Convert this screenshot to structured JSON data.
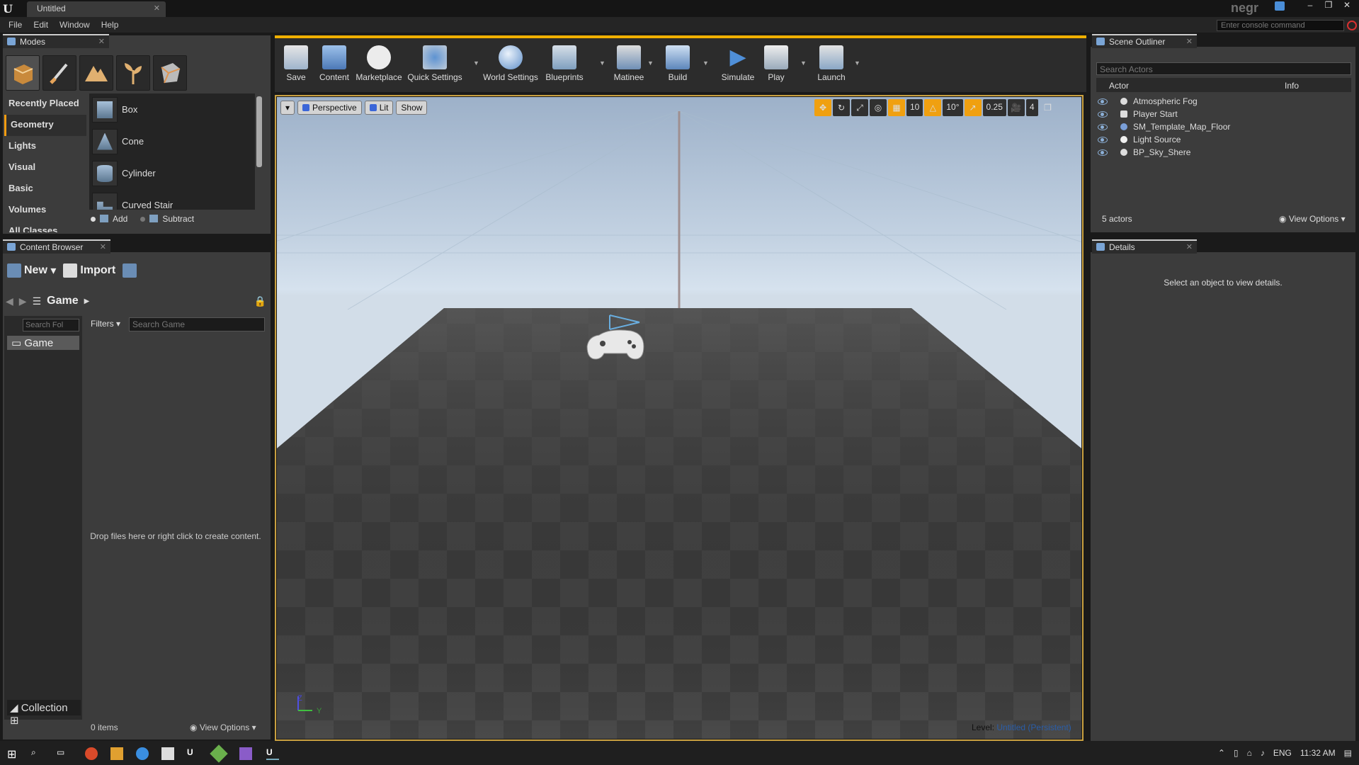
{
  "app": {
    "document_tab": "Untitled",
    "user": "negr",
    "console_placeholder": "Enter console command"
  },
  "menu": [
    "File",
    "Edit",
    "Window",
    "Help"
  ],
  "modes": {
    "tab": "Modes",
    "categories": [
      "Recently Placed",
      "Geometry",
      "Lights",
      "Visual",
      "Basic",
      "Volumes",
      "All Classes"
    ],
    "items": [
      "Box",
      "Cone",
      "Cylinder",
      "Curved Stair"
    ],
    "brush_add": "Add",
    "brush_subtract": "Subtract"
  },
  "content_browser": {
    "tab": "Content Browser",
    "new_label": "New",
    "import_label": "Import",
    "path": "Game",
    "search_folders_placeholder": "Search Fol",
    "folder": "Game",
    "filters": "Filters",
    "search_placeholder": "Search Game",
    "drop_hint": "Drop files here or right click to create content.",
    "collections": "Collection",
    "item_count": "0 items",
    "view_options": "View Options"
  },
  "toolbar": {
    "buttons": [
      "Save",
      "Content",
      "Marketplace",
      "Quick Settings",
      "World Settings",
      "Blueprints",
      "Matinee",
      "Build",
      "Simulate",
      "Play",
      "Launch"
    ]
  },
  "viewport": {
    "perspective": "Perspective",
    "lit": "Lit",
    "show": "Show",
    "grid_snap": "10",
    "rot_snap": "10°",
    "scale_snap": "0.25",
    "cam_speed": "4",
    "level_prefix": "Level:",
    "level_name": "Untitled (Persistent)",
    "axis_z": "Z",
    "axis_y": "Y"
  },
  "scene_outliner": {
    "tab": "Scene Outliner",
    "search_placeholder": "Search Actors",
    "col_actor": "Actor",
    "col_info": "Info",
    "actors": [
      "Atmospheric Fog",
      "Player Start",
      "SM_Template_Map_Floor",
      "Light Source",
      "BP_Sky_Shere"
    ],
    "count": "5 actors",
    "view_options": "View Options"
  },
  "details": {
    "tab": "Details",
    "hint": "Select an object to view details."
  },
  "taskbar": {
    "lang": "ENG",
    "time": "11:32 AM"
  },
  "colors": {
    "accent": "#f0b000",
    "panel": "#3c3c3c",
    "selected_cat": "#f39c12"
  }
}
